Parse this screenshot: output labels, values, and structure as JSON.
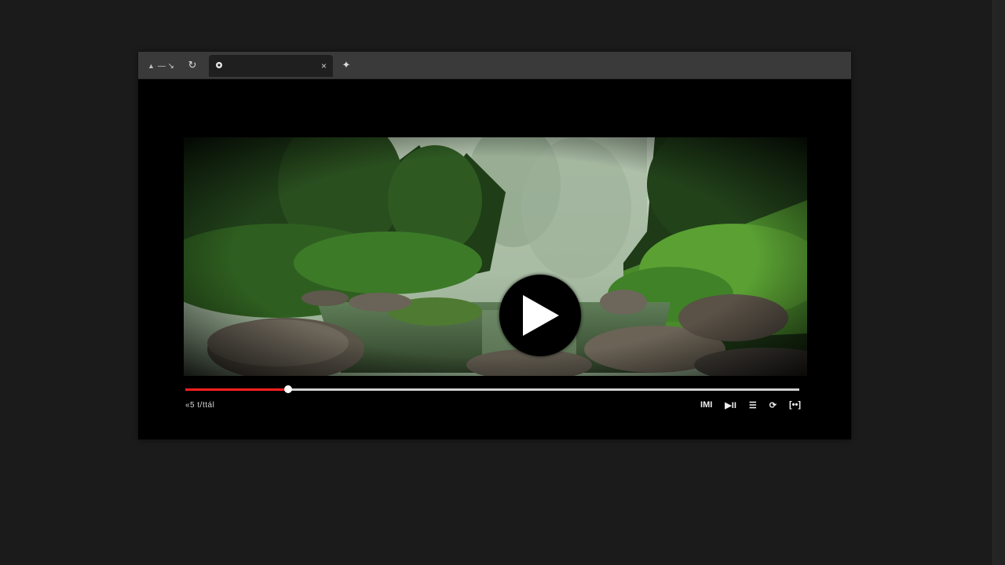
{
  "browser": {
    "inactive_tab_label": "— ↘",
    "active_tab_close": "×",
    "reload_glyph": "↻",
    "newtab_glyph": "✦"
  },
  "player": {
    "progress_fraction": 0.168,
    "time_text": "«5  t/ttál",
    "accent_color": "#ff1f1f",
    "controls": {
      "hd_label": "I­M­I",
      "next_label": "▶II",
      "subtitles_label": "☰",
      "settings_label": "⟳",
      "fullscreen_label": "[••]"
    }
  },
  "icons": {
    "tab_favicon": "home-icon",
    "active_favicon": "site-icon",
    "play": "play-icon"
  }
}
